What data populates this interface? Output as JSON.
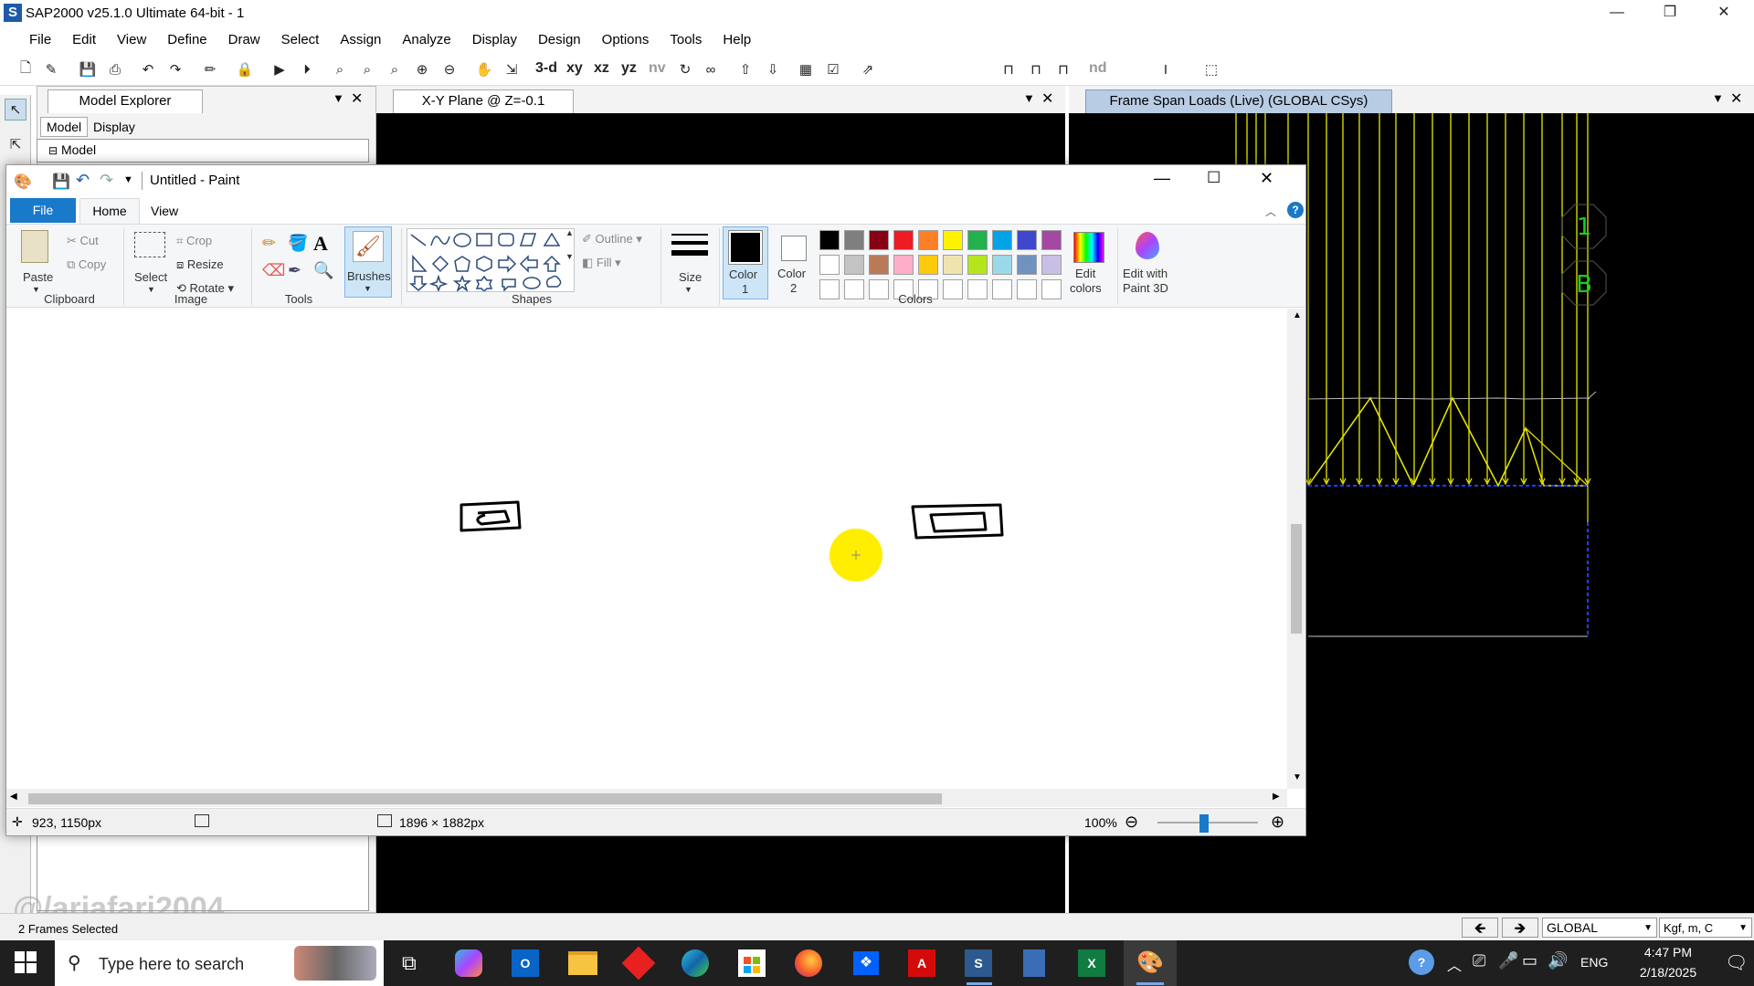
{
  "sap": {
    "title": "SAP2000 v25.1.0 Ultimate 64-bit - 1",
    "logo": "S",
    "menu": [
      "File",
      "Edit",
      "View",
      "Define",
      "Draw",
      "Select",
      "Assign",
      "Analyze",
      "Display",
      "Design",
      "Options",
      "Tools",
      "Help"
    ],
    "toolbar_text": [
      "3-d",
      "xy",
      "xz",
      "yz",
      "nv",
      "nd"
    ],
    "explorer": {
      "title": "Model Explorer",
      "tabs": [
        "Model",
        "Display"
      ],
      "tree_root": "Model"
    },
    "mid_window": {
      "title": "X-Y Plane @ Z=-0.1"
    },
    "right_window": {
      "title": "Frame Span Loads (Live) (GLOBAL CSys)",
      "bubbles": [
        "1",
        "B"
      ]
    },
    "status": {
      "left": "2 Frames Selected",
      "csys": "GLOBAL",
      "units": "Kgf, m, C",
      "watermark": "@/ariafari2004"
    }
  },
  "paint": {
    "title": "Untitled - Paint",
    "tabs": {
      "file": "File",
      "home": "Home",
      "view": "View"
    },
    "clipboard": {
      "paste": "Paste",
      "cut": "Cut",
      "copy": "Copy",
      "group": "Clipboard"
    },
    "image": {
      "select": "Select",
      "crop": "Crop",
      "resize": "Resize",
      "rotate": "Rotate",
      "group": "Image"
    },
    "tools": {
      "group": "Tools"
    },
    "brushes": "Brushes",
    "shapes": {
      "outline": "Outline",
      "fill": "Fill",
      "group": "Shapes"
    },
    "size": "Size",
    "color1": [
      "Color",
      "1"
    ],
    "color2": [
      "Color",
      "2"
    ],
    "colors_group": "Colors",
    "edit_colors": [
      "Edit",
      "colors"
    ],
    "edit_3d": [
      "Edit with",
      "Paint 3D"
    ],
    "palette_row1": [
      "#000000",
      "#7f7f7f",
      "#880015",
      "#ed1c24",
      "#ff7f27",
      "#fff200",
      "#22b14c",
      "#00a2e8",
      "#3f48cc",
      "#a349a4"
    ],
    "palette_row2": [
      "#ffffff",
      "#c3c3c3",
      "#b97a57",
      "#ffaec9",
      "#ffc90e",
      "#efe4b0",
      "#b5e61d",
      "#99d9ea",
      "#7092be",
      "#c8bfe7"
    ],
    "status": {
      "cursor": "923, 1150px",
      "size": "1896 × 1882px",
      "zoom": "100%"
    }
  },
  "taskbar": {
    "search_placeholder": "Type here to search",
    "time": "4:47 PM",
    "date": "2/18/2025",
    "lang": "ENG"
  }
}
